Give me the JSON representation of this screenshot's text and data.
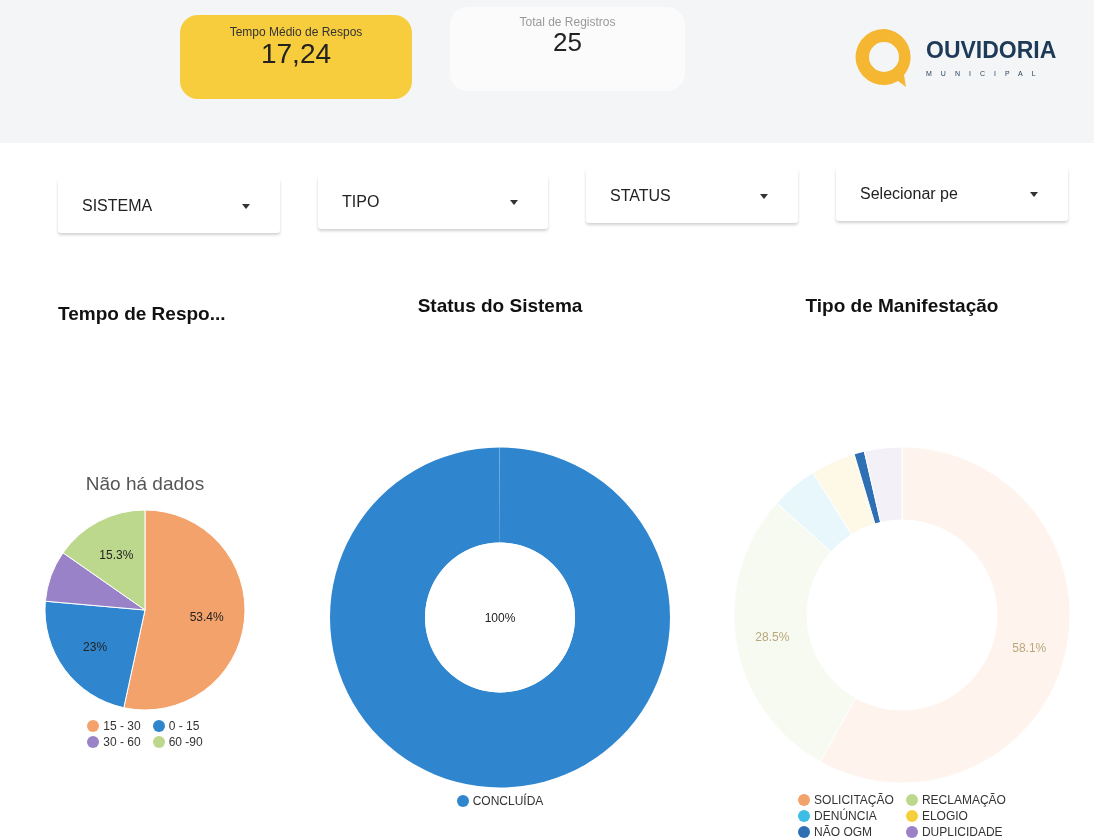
{
  "header": {
    "cards": [
      {
        "label": "Tempo Médio de Respos",
        "value": "17,24",
        "selected": true
      },
      {
        "label": "Total de Registros",
        "value": "25",
        "selected": false
      }
    ],
    "logo": {
      "title": "OUVIDORIA",
      "subtitle": "MUNICIPAL"
    }
  },
  "filters": [
    {
      "label": "SISTEMA"
    },
    {
      "label": "TIPO"
    },
    {
      "label": "STATUS"
    },
    {
      "label": "Selecionar pe"
    }
  ],
  "charts": [
    {
      "title": "Tempo de Respo...",
      "note": "Não há dados",
      "chart_data": {
        "type": "pie",
        "categories": [
          "15 - 30",
          "0 - 15",
          "30 - 60",
          "60 -90"
        ],
        "values": [
          53.4,
          23,
          8.3,
          15.3
        ],
        "colors": [
          "#f4a26b",
          "#2f86cf",
          "#9a82c9",
          "#bcd88d"
        ],
        "value_labels": [
          "53.4%",
          "23%",
          null,
          "15.3%"
        ]
      }
    },
    {
      "title": "Status do Sistema",
      "chart_data": {
        "type": "donut",
        "categories": [
          "CONCLUÍDA"
        ],
        "values": [
          100
        ],
        "colors": [
          "#2f86cf"
        ],
        "value_labels": [
          "100%"
        ]
      }
    },
    {
      "title": "Tipo de Manifestação",
      "slice_states": [
        {
          "highlighted": false
        },
        {
          "highlighted": false
        },
        {
          "highlighted": false
        },
        {
          "highlighted": false
        },
        {
          "highlighted": true
        },
        {
          "highlighted": false
        }
      ],
      "chart_data": {
        "type": "donut",
        "categories": [
          "SOLICITAÇÃO",
          "RECLAMAÇÃO",
          "DENÚNCIA",
          "ELOGIO",
          "NÃO OGM",
          "DUPLICIDADE"
        ],
        "values": [
          58.1,
          28.5,
          4.5,
          4.3,
          1,
          3.6
        ],
        "colors": [
          "#f4a26b",
          "#bcd88d",
          "#3bbde6",
          "#f7cf3c",
          "#2f6fb3",
          "#9a82c9"
        ],
        "value_labels": [
          "58.1%",
          "28.5%",
          null,
          null,
          null,
          null
        ]
      }
    }
  ]
}
